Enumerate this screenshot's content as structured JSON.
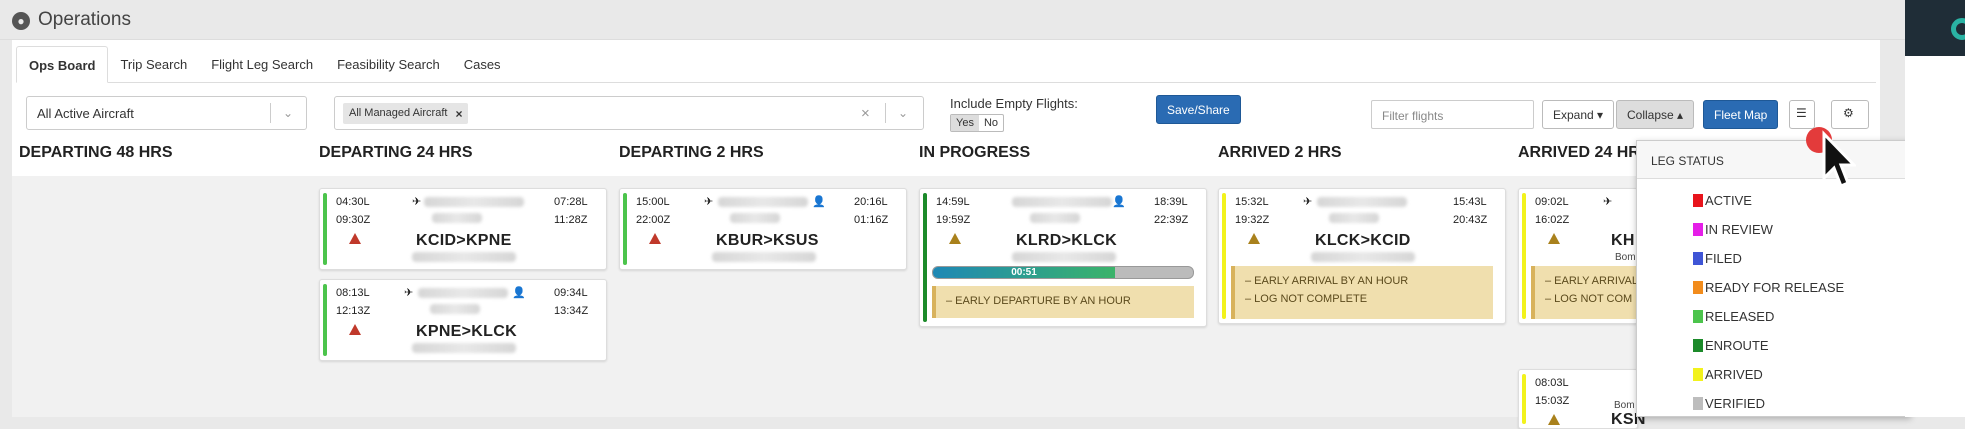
{
  "app": {
    "title": "Operations"
  },
  "tabs": [
    {
      "label": "Ops Board"
    },
    {
      "label": "Trip Search"
    },
    {
      "label": "Flight Leg Search"
    },
    {
      "label": "Feasibility Search"
    },
    {
      "label": "Cases"
    }
  ],
  "filters": {
    "aircraft_select": "All Active Aircraft",
    "managed_chip": "All Managed Aircraft",
    "include_empty_label": "Include Empty Flights:",
    "yes": "Yes",
    "no": "No",
    "save_share": "Save/Share",
    "filter_placeholder": "Filter flights",
    "expand": "Expand",
    "collapse": "Collapse",
    "fleet_map": "Fleet Map"
  },
  "columns": [
    {
      "title": "DEPARTING 48 HRS"
    },
    {
      "title": "DEPARTING 24 HRS"
    },
    {
      "title": "DEPARTING 2 HRS"
    },
    {
      "title": "IN PROGRESS"
    },
    {
      "title": "ARRIVED 2 HRS"
    },
    {
      "title": "ARRIVED 24 HRS"
    }
  ],
  "cards": [
    {
      "dep_local": "04:30L",
      "dep_zulu": "09:30Z",
      "arr_local": "07:28L",
      "arr_zulu": "11:28Z",
      "route": "KCID>KPNE"
    },
    {
      "dep_local": "08:13L",
      "dep_zulu": "12:13Z",
      "arr_local": "09:34L",
      "arr_zulu": "13:34Z",
      "route": "KPNE>KLCK"
    },
    {
      "dep_local": "15:00L",
      "dep_zulu": "22:00Z",
      "arr_local": "20:16L",
      "arr_zulu": "01:16Z",
      "route": "KBUR>KSUS"
    },
    {
      "dep_local": "14:59L",
      "dep_zulu": "19:59Z",
      "arr_local": "18:39L",
      "arr_zulu": "22:39Z",
      "route": "KLRD>KLCK",
      "progress_label": "00:51",
      "progress": 0.7,
      "note": "– EARLY DEPARTURE BY AN HOUR"
    },
    {
      "dep_local": "15:32L",
      "dep_zulu": "19:32Z",
      "arr_local": "15:43L",
      "arr_zulu": "20:43Z",
      "route": "KLCK>KCID",
      "note1": "– EARLY ARRIVAL BY AN HOUR",
      "note2": "– LOG NOT COMPLETE"
    },
    {
      "dep_local": "09:02L",
      "dep_zulu": "16:02Z",
      "route_partial": "KH",
      "tail_partial": "Bom",
      "note1": "– EARLY ARRIVAL",
      "note2": "– LOG NOT COM"
    },
    {
      "dep_local": "08:03L",
      "dep_zulu": "15:03Z",
      "route_partial": "KSN",
      "tail_partial": "Bom"
    }
  ],
  "leg_status": {
    "header": "LEG STATUS",
    "items": [
      {
        "label": "ACTIVE",
        "color": "#e8141c"
      },
      {
        "label": "IN REVIEW",
        "color": "#e51ee8"
      },
      {
        "label": "FILED",
        "color": "#3f55d6"
      },
      {
        "label": "READY FOR RELEASE",
        "color": "#f28c1c"
      },
      {
        "label": "RELEASED",
        "color": "#4cc44c"
      },
      {
        "label": "ENROUTE",
        "color": "#1c8a2a"
      },
      {
        "label": "ARRIVED",
        "color": "#f2f21c"
      },
      {
        "label": "VERIFIED",
        "color": "#bdbdbd"
      }
    ]
  },
  "colors": {
    "accent": "#2a6bb3",
    "note_bg": "#f0dfae"
  }
}
